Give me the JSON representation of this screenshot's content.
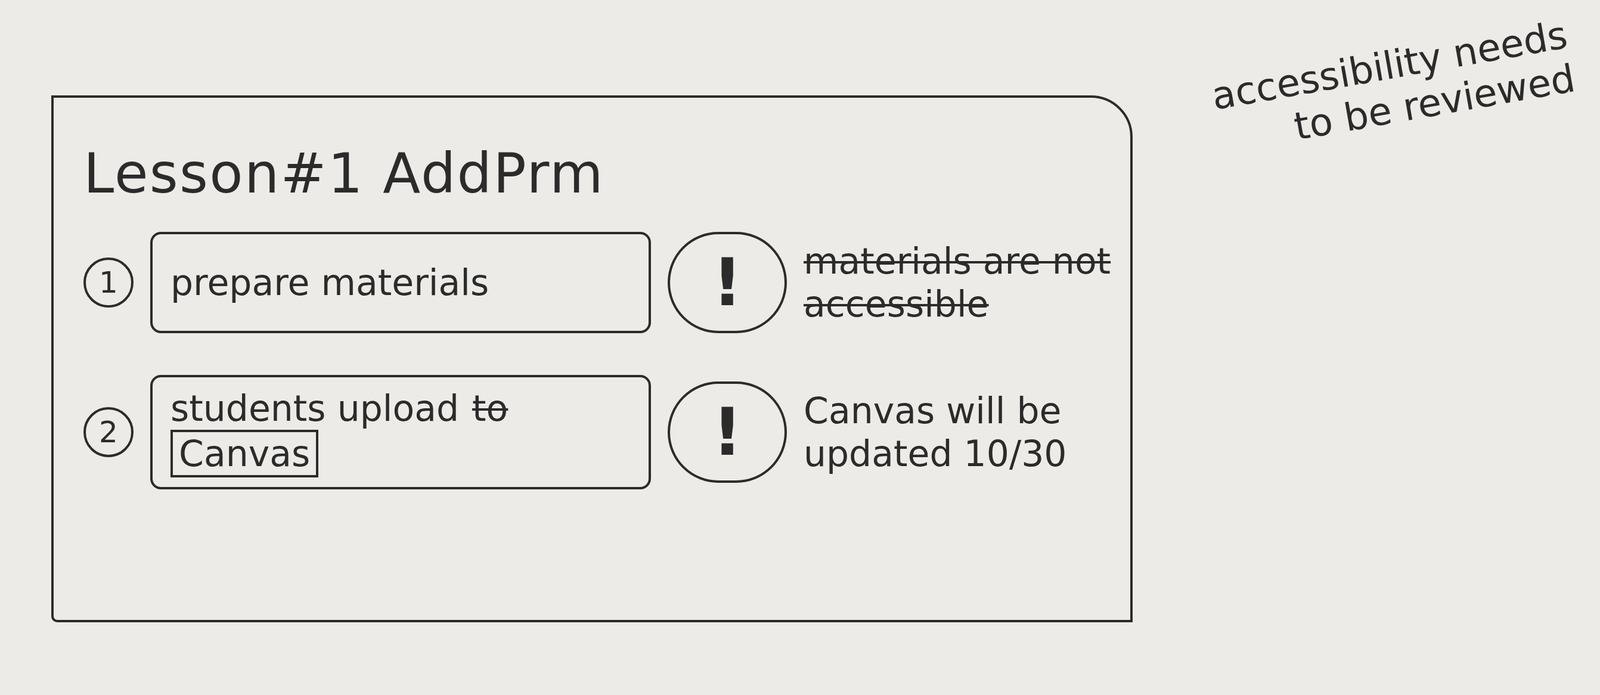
{
  "card": {
    "title": "Lesson#1 AddPrm"
  },
  "steps": [
    {
      "number": "1",
      "parts": [
        {
          "text": "prepare materials",
          "struck": false,
          "boxed": false
        }
      ],
      "warning": "!",
      "note": {
        "text": "materials are not accessible",
        "struck": true
      }
    },
    {
      "number": "2",
      "parts": [
        {
          "text": "students upload",
          "struck": false,
          "boxed": false
        },
        {
          "text": "to",
          "struck": true,
          "boxed": false
        },
        {
          "text": "Canvas",
          "struck": false,
          "boxed": true
        }
      ],
      "warning": "!",
      "note": {
        "text": "Canvas will be updated 10/30",
        "struck": false
      }
    }
  ],
  "margin_note": "accessibility needs to be reviewed"
}
